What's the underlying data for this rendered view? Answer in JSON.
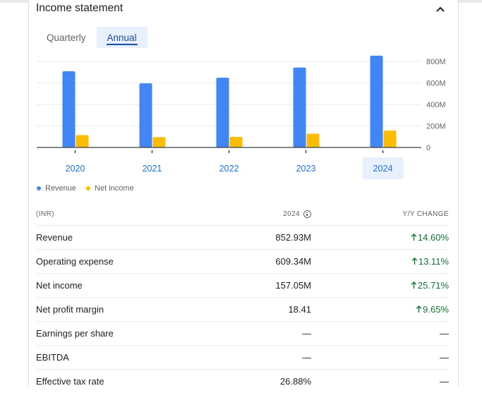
{
  "card": {
    "title": "Income statement"
  },
  "tabs": [
    {
      "label": "Quarterly",
      "active": false
    },
    {
      "label": "Annual",
      "active": true
    }
  ],
  "chart_data": {
    "type": "bar",
    "categories": [
      "2020",
      "2021",
      "2022",
      "2023",
      "2024"
    ],
    "series": [
      {
        "name": "Revenue",
        "color": "#4285f4",
        "values": [
          708,
          596,
          648,
          743,
          853
        ]
      },
      {
        "name": "Net income",
        "color": "#fbbc04",
        "values": [
          115,
          96,
          98,
          128,
          157
        ]
      }
    ],
    "yticks": [
      "0",
      "200M",
      "400M",
      "600M",
      "800M"
    ],
    "ylim": [
      0,
      800
    ],
    "selected_category": "2024",
    "legend_position": "bottom-left",
    "grid": true
  },
  "table": {
    "headers": {
      "label": "(INR)",
      "year": "2024",
      "change": "Y/Y CHANGE"
    },
    "rows": [
      {
        "label": "Revenue",
        "value": "852.93M",
        "change": "14.60%",
        "direction": "up"
      },
      {
        "label": "Operating expense",
        "value": "609.34M",
        "change": "13.11%",
        "direction": "up"
      },
      {
        "label": "Net income",
        "value": "157.05M",
        "change": "25.71%",
        "direction": "up"
      },
      {
        "label": "Net profit margin",
        "value": "18.41",
        "change": "9.65%",
        "direction": "up"
      },
      {
        "label": "Earnings per share",
        "value": "—",
        "change": "—",
        "direction": "none"
      },
      {
        "label": "EBITDA",
        "value": "—",
        "change": "—",
        "direction": "none"
      },
      {
        "label": "Effective tax rate",
        "value": "26.88%",
        "change": "—",
        "direction": "none"
      }
    ]
  }
}
